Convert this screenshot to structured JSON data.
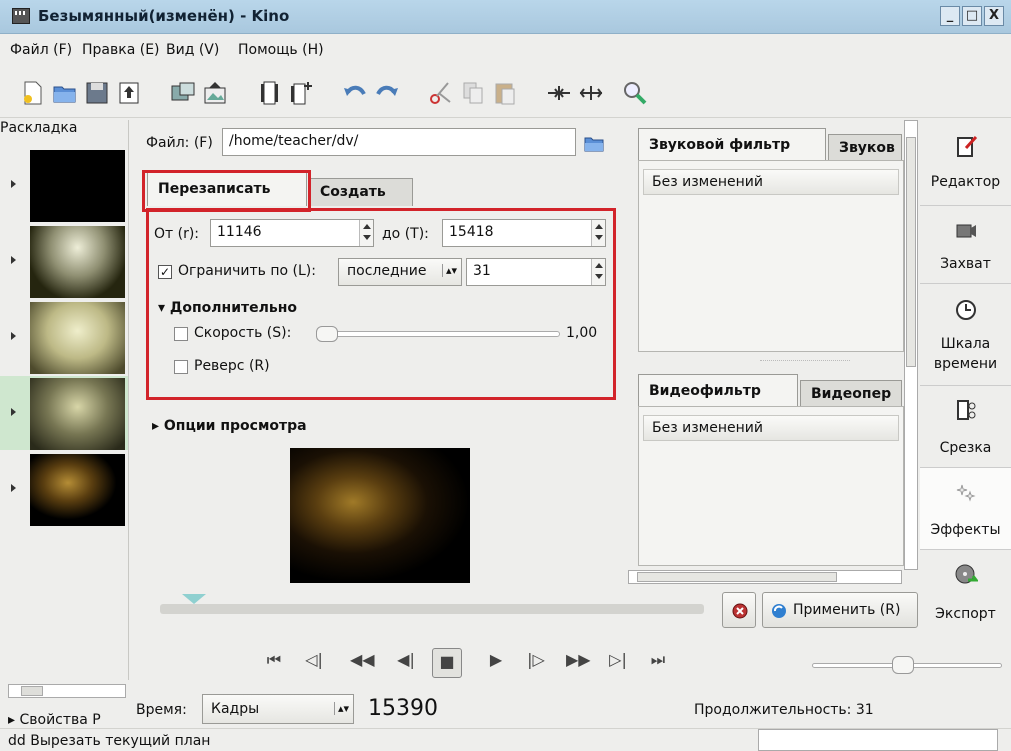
{
  "window": {
    "title": "Безымянный(изменён) - Kino",
    "controls": [
      "_",
      "□",
      "X"
    ]
  },
  "menu": [
    {
      "label": "Файл (F)"
    },
    {
      "label": "Правка (E)"
    },
    {
      "label": "Вид (V)"
    },
    {
      "label": "Помощь (H)"
    }
  ],
  "toolbar_icons": [
    "new-document-icon",
    "open-folder-icon",
    "save-icon",
    "export-icon",
    "capture-icon",
    "still-image-icon",
    "film-insert-icon",
    "film-append-icon",
    "undo-icon",
    "redo-icon",
    "cut-icon",
    "copy-icon",
    "paste-icon",
    "join-icon",
    "split-icon",
    "zoom-icon"
  ],
  "left": {
    "layout_label": "Раскладка",
    "properties_label": "▸ Свойства P"
  },
  "file": {
    "label": "Файл: (F)",
    "value": "/home/teacher/dv/"
  },
  "tabs": {
    "rewrite": "Перезаписать",
    "create": "Создать"
  },
  "range": {
    "from_label": "От (r):",
    "from_value": "11146",
    "to_label": "до (T):",
    "to_value": "15418"
  },
  "limit": {
    "checked": true,
    "check_mark": "✓",
    "label": "Ограничить по (L):",
    "mode": "последние",
    "value": "31"
  },
  "advanced": {
    "label": "Дополнительно",
    "speed_label": "Скорость (S):",
    "speed_value": "1,00",
    "reverse_label": "Реверс (R)"
  },
  "preview_options_label": "Опции просмотра",
  "audio": {
    "tab_active": "Звуковой фильтр",
    "tab_other": "Звуков",
    "combo_value": "Без изменений"
  },
  "video": {
    "tab_active": "Видеофильтр",
    "tab_other": "Видеопер",
    "combo_value": "Без изменений"
  },
  "buttons": {
    "apply": "Применить (R)"
  },
  "sidebar": [
    {
      "label": "Редактор",
      "icon": "editor-icon"
    },
    {
      "label": "Захват",
      "icon": "camera-icon"
    },
    {
      "label": "Шкала времени",
      "icon": "clock-icon"
    },
    {
      "label": "Срезка",
      "icon": "trim-icon"
    },
    {
      "label": "Эффекты",
      "icon": "effects-icon"
    },
    {
      "label": "Экспорт",
      "icon": "export-reel-icon"
    }
  ],
  "transport": [
    "⏮",
    "◁|",
    "◀◀",
    "◀|",
    "■",
    "▶",
    "|▷",
    "▶▶",
    "▷|",
    "⏭"
  ],
  "time": {
    "label": "Время:",
    "mode": "Кадры",
    "frame": "15390",
    "duration": "Продолжительность: 31"
  },
  "status": "dd  Вырезать текущий план"
}
